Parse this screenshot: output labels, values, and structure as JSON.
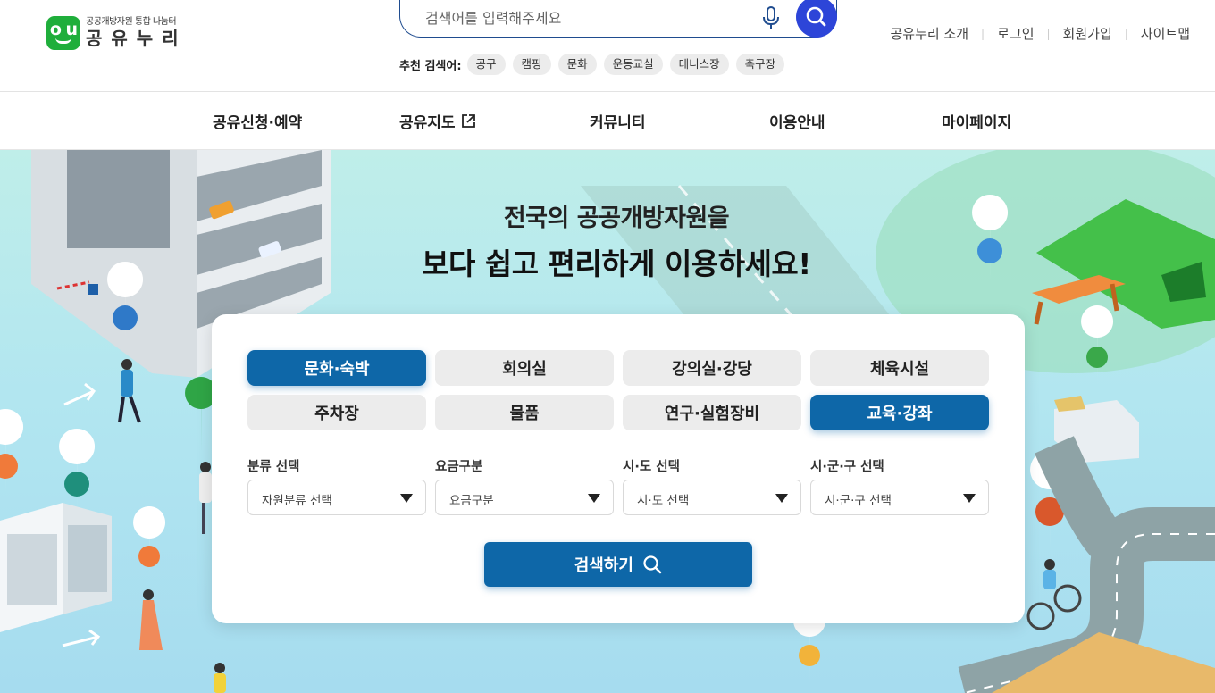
{
  "header": {
    "logo": {
      "sub": "공공개방자원 통합 나눔터",
      "main": "공유누리"
    },
    "search": {
      "placeholder": "검색어를 입력해주세요"
    },
    "recommend": {
      "label": "추천 검색어:",
      "chips": [
        "공구",
        "캠핑",
        "문화",
        "운동교실",
        "테니스장",
        "축구장"
      ]
    },
    "util_links": [
      "공유누리 소개",
      "로그인",
      "회원가입",
      "사이트맵"
    ]
  },
  "gnb": {
    "items": [
      "공유신청·예약",
      "공유지도",
      "커뮤니티",
      "이용안내",
      "마이페이지"
    ]
  },
  "hero": {
    "line1": "전국의 공공개방자원을",
    "line2": "보다 쉽고 편리하게 이용하세요!"
  },
  "card": {
    "categories": [
      {
        "label": "문화·숙박",
        "active": true
      },
      {
        "label": "회의실",
        "active": false
      },
      {
        "label": "강의실·강당",
        "active": false
      },
      {
        "label": "체육시설",
        "active": false
      },
      {
        "label": "주차장",
        "active": false
      },
      {
        "label": "물품",
        "active": false
      },
      {
        "label": "연구·실험장비",
        "active": false
      },
      {
        "label": "교육·강좌",
        "active": true
      }
    ],
    "filters": [
      {
        "label": "분류 선택",
        "value": "자원분류 선택"
      },
      {
        "label": "요금구분",
        "value": "요금구분"
      },
      {
        "label": "시·도 선택",
        "value": "시·도 선택"
      },
      {
        "label": "시·군·구 선택",
        "value": "시·군·구 선택"
      }
    ],
    "submit": "검색하기"
  },
  "colors": {
    "primary": "#0e67a8",
    "search_button": "#2d45d8",
    "logo_green": "#1fae3b",
    "hero_bg": "#b2e6f0"
  }
}
